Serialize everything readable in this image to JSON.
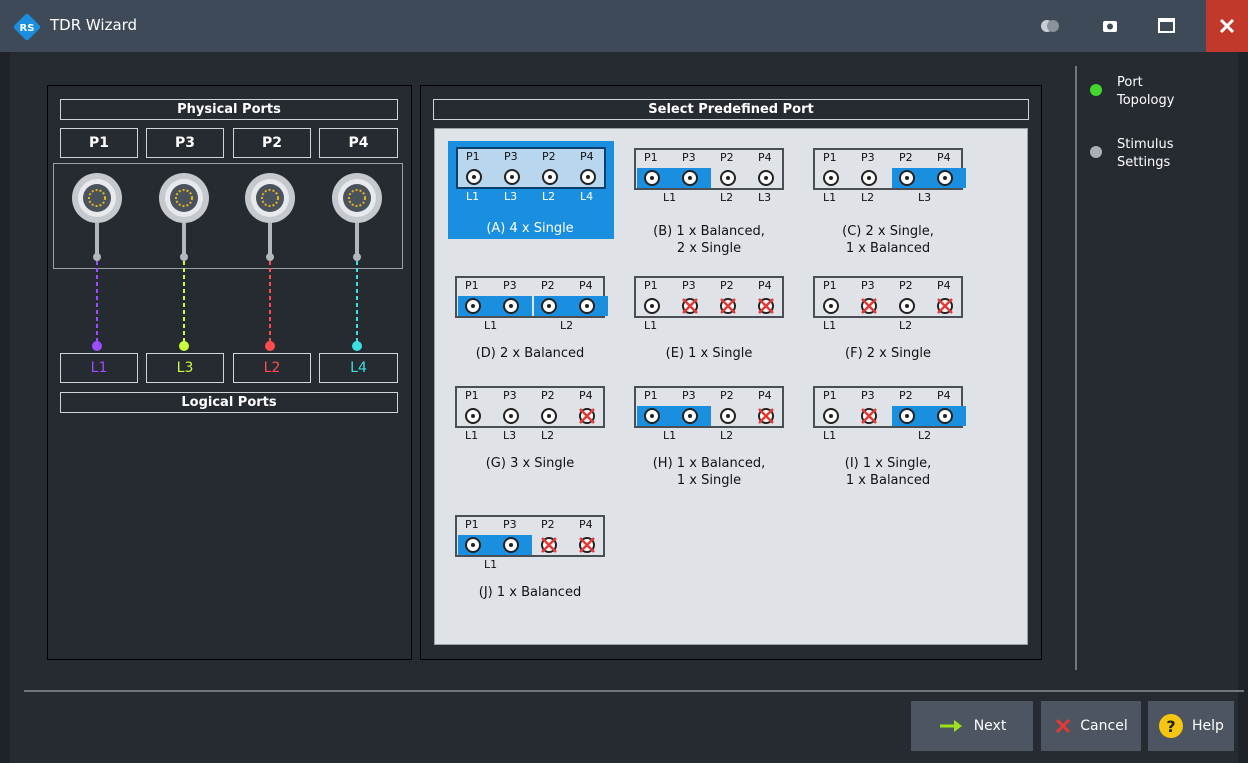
{
  "window": {
    "title": "TDR Wizard"
  },
  "left": {
    "physical_header": "Physical Ports",
    "logical_header": "Logical Ports",
    "physical_ports": [
      "P1",
      "P3",
      "P2",
      "P4"
    ],
    "logical_ports": [
      {
        "label": "L1",
        "color": "#9b4dff"
      },
      {
        "label": "L3",
        "color": "#c8ff3c"
      },
      {
        "label": "L2",
        "color": "#ff4c4c"
      },
      {
        "label": "L4",
        "color": "#3ce0e0"
      }
    ]
  },
  "middle": {
    "header": "Select Predefined Port",
    "options": [
      {
        "caption1": "(A) 4 x Single",
        "caption2": "",
        "ports": [
          "P1",
          "P3",
          "P2",
          "P4"
        ],
        "logicals": [
          "L1",
          "L3",
          "L2",
          "L4"
        ]
      },
      {
        "caption1": "(B) 1 x Balanced,",
        "caption2": "2 x Single",
        "ports": [
          "P1",
          "P3",
          "P2",
          "P4"
        ],
        "logicals": [
          "L1",
          "L2",
          "L3"
        ]
      },
      {
        "caption1": "(C) 2 x Single,",
        "caption2": "1 x Balanced",
        "ports": [
          "P1",
          "P3",
          "P2",
          "P4"
        ],
        "logicals": [
          "L1",
          "L2",
          "L3"
        ]
      },
      {
        "caption1": "(D) 2 x Balanced",
        "caption2": "",
        "ports": [
          "P1",
          "P3",
          "P2",
          "P4"
        ],
        "logicals": [
          "L1",
          "L2"
        ]
      },
      {
        "caption1": "(E) 1 x Single",
        "caption2": "",
        "ports": [
          "P1",
          "P3",
          "P2",
          "P4"
        ],
        "logicals": [
          "L1"
        ]
      },
      {
        "caption1": "(F) 2 x Single",
        "caption2": "",
        "ports": [
          "P1",
          "P3",
          "P2",
          "P4"
        ],
        "logicals": [
          "L1",
          "L2"
        ]
      },
      {
        "caption1": "(G) 3 x Single",
        "caption2": "",
        "ports": [
          "P1",
          "P3",
          "P2",
          "P4"
        ],
        "logicals": [
          "L1",
          "L3",
          "L2"
        ]
      },
      {
        "caption1": "(H) 1 x Balanced,",
        "caption2": "1 x Single",
        "ports": [
          "P1",
          "P3",
          "P2",
          "P4"
        ],
        "logicals": [
          "L1",
          "L2"
        ]
      },
      {
        "caption1": "(I) 1 x Single,",
        "caption2": "1 x Balanced",
        "ports": [
          "P1",
          "P3",
          "P2",
          "P4"
        ],
        "logicals": [
          "L1",
          "L2"
        ]
      },
      {
        "caption1": "(J) 1 x Balanced",
        "caption2": "",
        "ports": [
          "P1",
          "P3",
          "P2",
          "P4"
        ],
        "logicals": [
          "L1"
        ]
      }
    ]
  },
  "steps": [
    {
      "line1": "Port",
      "line2": "Topology",
      "active": true
    },
    {
      "line1": "Stimulus",
      "line2": "Settings",
      "active": false
    }
  ],
  "buttons": {
    "next": "Next",
    "cancel": "Cancel",
    "help": "Help"
  },
  "colors": {
    "accent": "#1a8fe0",
    "active_step": "#44d62c",
    "close": "#c0392b"
  }
}
